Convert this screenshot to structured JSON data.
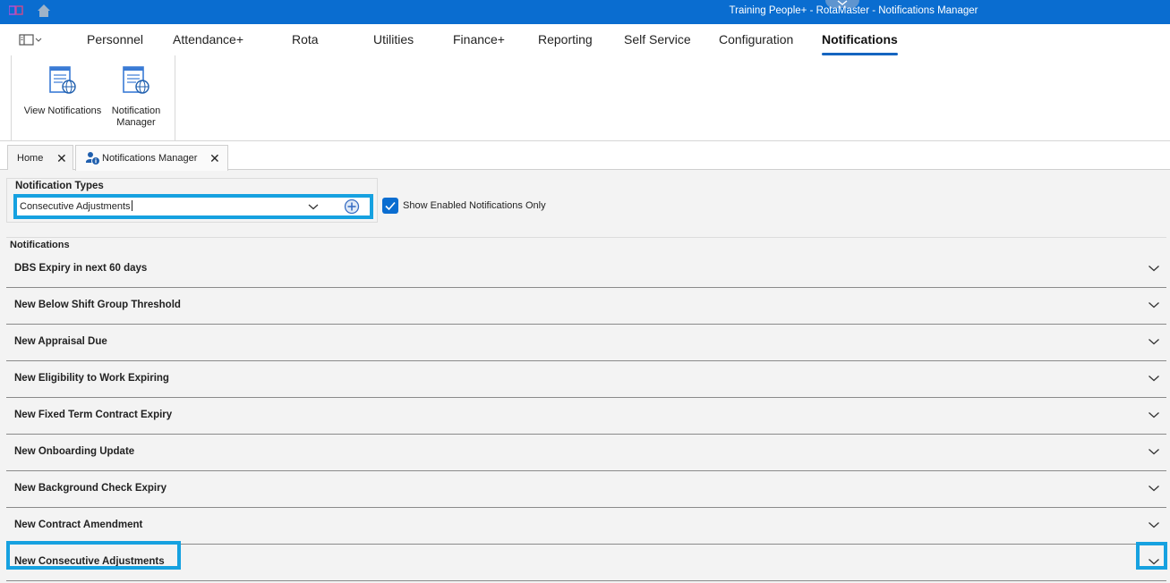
{
  "window": {
    "title": "Training People+ - RotaMaster - Notifications Manager"
  },
  "menu": {
    "items": [
      {
        "label": "Personnel"
      },
      {
        "label": "Attendance+"
      },
      {
        "label": "Rota"
      },
      {
        "label": "Utilities"
      },
      {
        "label": "Finance+"
      },
      {
        "label": "Reporting"
      },
      {
        "label": "Self Service"
      },
      {
        "label": "Configuration"
      },
      {
        "label": "Notifications",
        "active": true
      }
    ]
  },
  "ribbon": {
    "buttons": [
      {
        "label": "View Notifications",
        "icon": "document-globe-icon"
      },
      {
        "label": "Notification Manager",
        "icon": "document-globe-icon"
      }
    ]
  },
  "tabs": [
    {
      "label": "Home"
    },
    {
      "label": "Notifications Manager",
      "active": true,
      "icon": "users-info-icon"
    }
  ],
  "notification_types": {
    "label": "Notification Types",
    "selected": "Consecutive Adjustments",
    "show_enabled_only": {
      "label": "Show Enabled Notifications Only",
      "checked": true
    }
  },
  "notifications": {
    "label": "Notifications",
    "items": [
      {
        "label": "DBS Expiry in next 60 days"
      },
      {
        "label": "New Below Shift Group Threshold"
      },
      {
        "label": "New Appraisal Due"
      },
      {
        "label": "New Eligibility to Work Expiring"
      },
      {
        "label": "New Fixed Term Contract Expiry"
      },
      {
        "label": "New Onboarding Update"
      },
      {
        "label": "New Background Check Expiry"
      },
      {
        "label": "New Contract Amendment"
      },
      {
        "label": "New Consecutive Adjustments",
        "highlighted": true
      }
    ]
  },
  "colors": {
    "titlebar": "#0a6dd0",
    "highlight": "#16a1e0",
    "active_underline": "#1565c0"
  }
}
